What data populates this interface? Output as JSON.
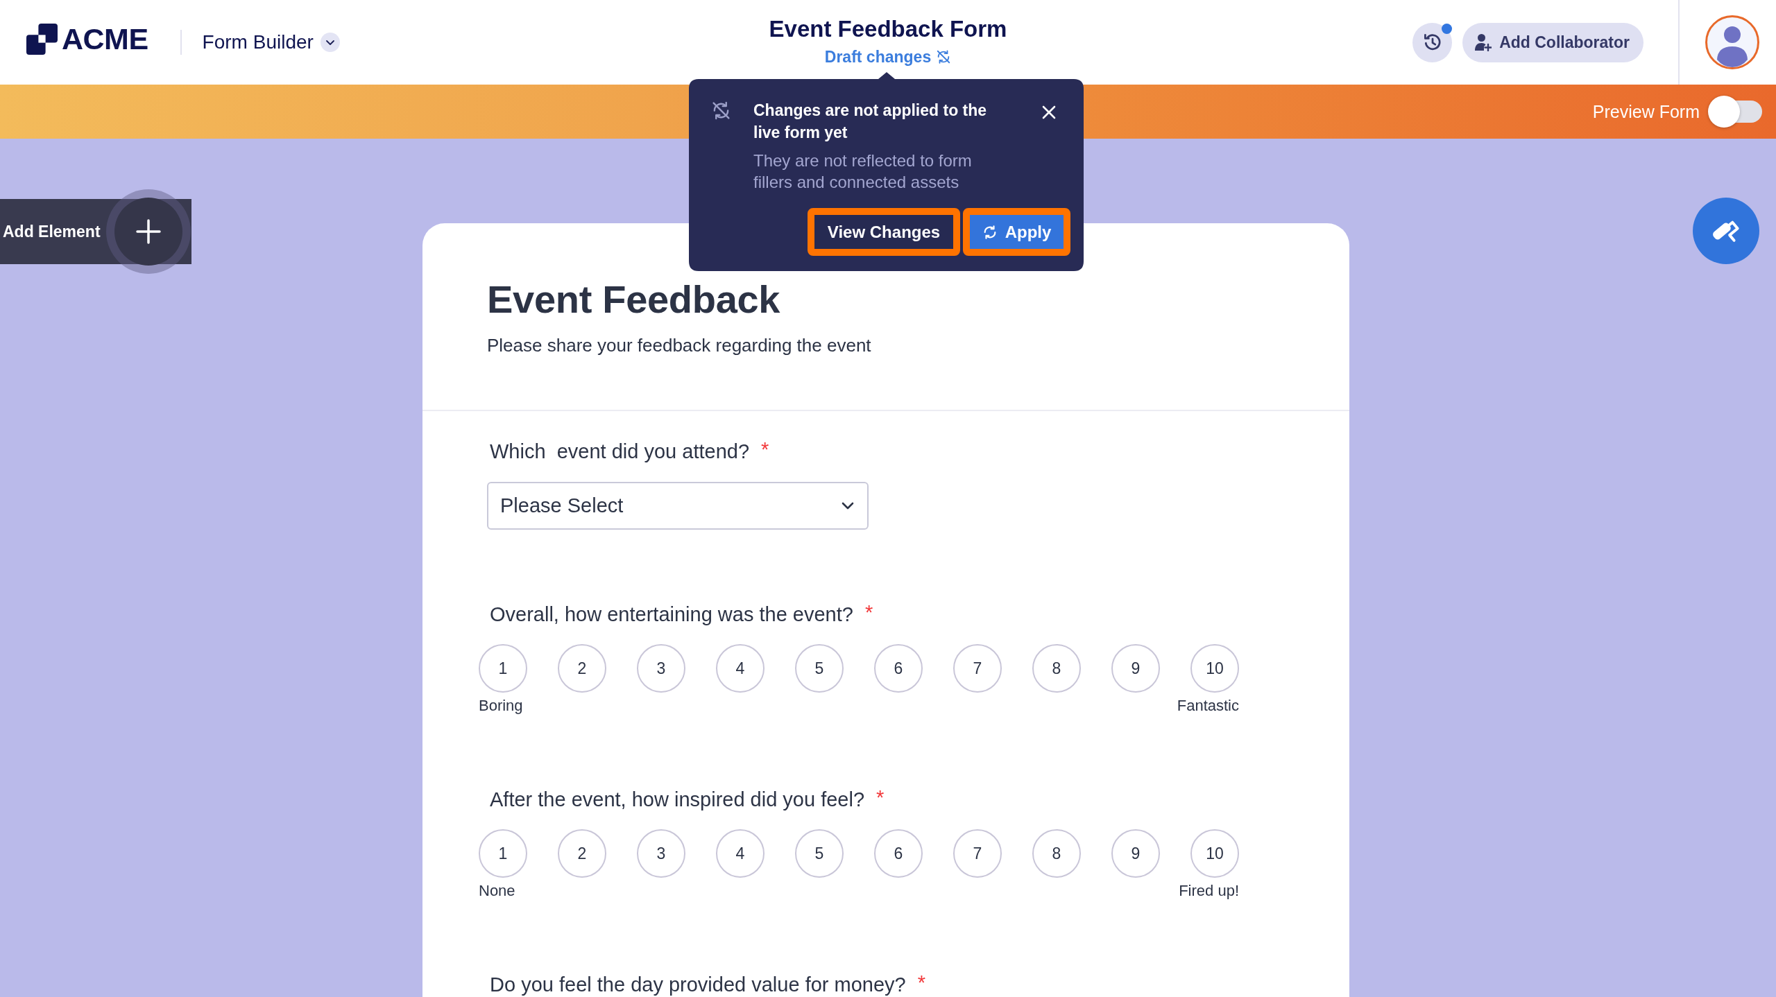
{
  "header": {
    "logo": "ACME",
    "app_menu": "Form Builder",
    "title": "Event Feedback Form",
    "status": "Draft changes",
    "history_unread": true,
    "add_collaborator": "Add Collaborator"
  },
  "toolbar": {
    "preview_label": "Preview Form",
    "preview_on": false
  },
  "canvas": {
    "add_element": "Add Element"
  },
  "form": {
    "title": "Event Feedback",
    "description": "Please share your feedback regarding the event",
    "questions": [
      {
        "label": "Which  event did you attend?",
        "required_mark": "*",
        "dropdown": {
          "placeholder": "Please Select"
        }
      },
      {
        "label": "Overall, how entertaining was the event?",
        "required_mark": "*",
        "rating": {
          "options": [
            {
              "label": "1",
              "selected": false
            },
            {
              "label": "2",
              "selected": false
            },
            {
              "label": "3",
              "selected": false
            },
            {
              "label": "4",
              "selected": false
            },
            {
              "label": "5",
              "selected": false
            },
            {
              "label": "6",
              "selected": false
            },
            {
              "label": "7",
              "selected": false
            },
            {
              "label": "8",
              "selected": false
            },
            {
              "label": "9",
              "selected": false
            },
            {
              "label": "10",
              "selected": false
            }
          ],
          "low_label": "Boring",
          "high_label": "Fantastic"
        }
      },
      {
        "label": "After the event, how inspired did you feel?",
        "required_mark": "*",
        "rating": {
          "options": [
            {
              "label": "1",
              "selected": false
            },
            {
              "label": "2",
              "selected": false
            },
            {
              "label": "3",
              "selected": false
            },
            {
              "label": "4",
              "selected": false
            },
            {
              "label": "5",
              "selected": false
            },
            {
              "label": "6",
              "selected": false
            },
            {
              "label": "7",
              "selected": false
            },
            {
              "label": "8",
              "selected": false
            },
            {
              "label": "9",
              "selected": false
            },
            {
              "label": "10",
              "selected": false
            }
          ],
          "low_label": "None",
          "high_label": "Fired up!"
        }
      },
      {
        "label": "Do you feel the day provided value for money?",
        "required_mark": "*"
      }
    ]
  },
  "popup": {
    "title": "Changes are not applied to the live form yet",
    "description": "They are not reflected to form fillers and connected assets",
    "buttons": [
      {
        "label": "View Changes",
        "kind": "secondary",
        "highlighted": true
      },
      {
        "label": "Apply",
        "kind": "primary",
        "highlighted": true
      }
    ]
  }
}
